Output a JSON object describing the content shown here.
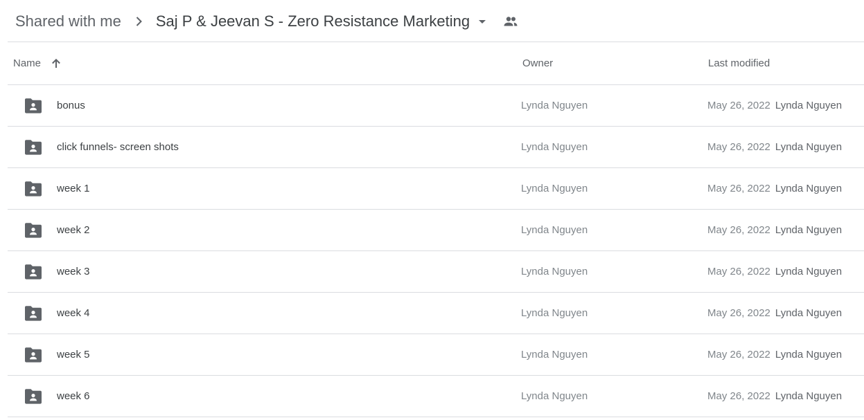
{
  "breadcrumb": {
    "parent": "Shared with me",
    "separator_icon": "chevron-right-icon",
    "current": "Saj P & Jeevan S - Zero Resistance Marketing",
    "dropdown_icon": "arrow-drop-down-icon",
    "shared_icon": "people-icon"
  },
  "columns": {
    "name": "Name",
    "name_sort_icon": "arrow-upward-icon",
    "owner": "Owner",
    "last_modified": "Last modified"
  },
  "rows": [
    {
      "name": "bonus",
      "owner": "Lynda Nguyen",
      "modified_date": "May 26, 2022",
      "modified_by": "Lynda Nguyen",
      "icon": "shared-folder-icon"
    },
    {
      "name": "click funnels- screen shots",
      "owner": "Lynda Nguyen",
      "modified_date": "May 26, 2022",
      "modified_by": "Lynda Nguyen",
      "icon": "shared-folder-icon"
    },
    {
      "name": "week 1",
      "owner": "Lynda Nguyen",
      "modified_date": "May 26, 2022",
      "modified_by": "Lynda Nguyen",
      "icon": "shared-folder-icon"
    },
    {
      "name": "week 2",
      "owner": "Lynda Nguyen",
      "modified_date": "May 26, 2022",
      "modified_by": "Lynda Nguyen",
      "icon": "shared-folder-icon"
    },
    {
      "name": "week 3",
      "owner": "Lynda Nguyen",
      "modified_date": "May 26, 2022",
      "modified_by": "Lynda Nguyen",
      "icon": "shared-folder-icon"
    },
    {
      "name": "week 4",
      "owner": "Lynda Nguyen",
      "modified_date": "May 26, 2022",
      "modified_by": "Lynda Nguyen",
      "icon": "shared-folder-icon"
    },
    {
      "name": "week 5",
      "owner": "Lynda Nguyen",
      "modified_date": "May 26, 2022",
      "modified_by": "Lynda Nguyen",
      "icon": "shared-folder-icon"
    },
    {
      "name": "week 6",
      "owner": "Lynda Nguyen",
      "modified_date": "May 26, 2022",
      "modified_by": "Lynda Nguyen",
      "icon": "shared-folder-icon"
    }
  ],
  "colors": {
    "icon": "#5f6368",
    "divider": "#dadce0",
    "text_primary": "#3c4043",
    "text_secondary": "#80868b"
  }
}
